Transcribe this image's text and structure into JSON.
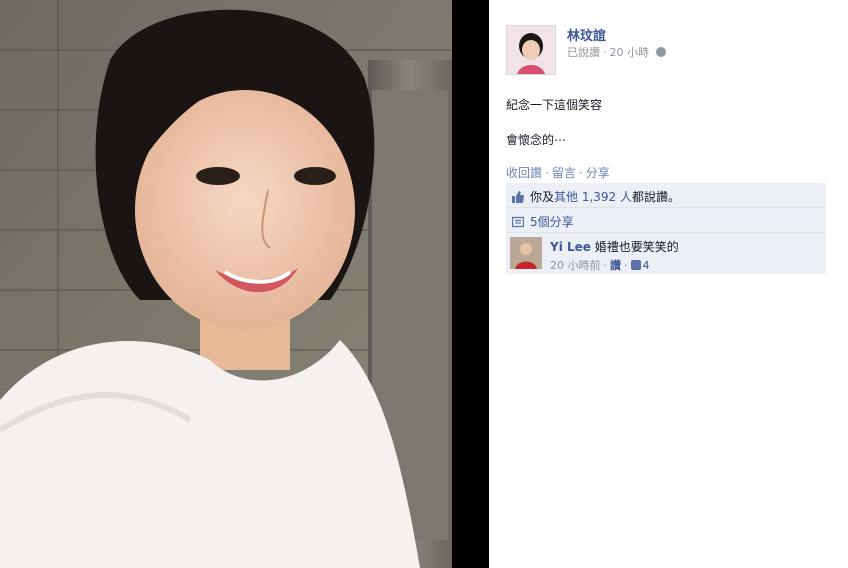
{
  "post": {
    "author": "林玟誼",
    "status": "已說讚",
    "time": "20 小時",
    "text_lines": [
      "紀念一下這個笑容",
      "會懷念的⋯"
    ]
  },
  "actions": {
    "unlike": "收回讚",
    "comment": "留言",
    "share": "分享"
  },
  "likes": {
    "prefix": "你及",
    "others_link": "其他 1,392 人",
    "suffix": "都說讚。"
  },
  "shares": {
    "label": "5個分享"
  },
  "comment": {
    "name": "Yi Lee",
    "text": "婚禮也要笑笑的",
    "time": "20 小時前",
    "like_label": "讚",
    "like_count": "4"
  },
  "colors": {
    "link": "#3b5998",
    "ufi_bg": "#eceff5",
    "meta": "#90949c"
  },
  "icons": [
    "globe-icon",
    "thumbs-up-icon",
    "share-icon",
    "like-small-icon"
  ]
}
